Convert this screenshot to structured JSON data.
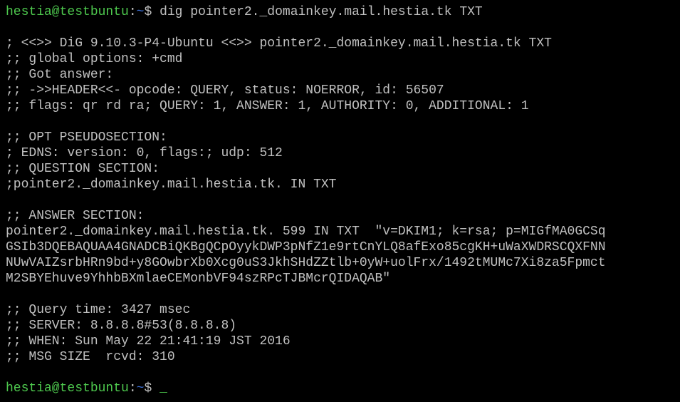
{
  "terminal": {
    "colors": {
      "background": "#000000",
      "foreground": "#c0c0c0",
      "prompt_user": "#4ec94e",
      "prompt_path": "#3b6fd8"
    },
    "prompt": {
      "user_host": "hestia@testbuntu",
      "separator": ":",
      "path": "~",
      "symbol": "$ "
    },
    "command": "dig pointer2._domainkey.mail.hestia.tk TXT",
    "output": [
      "",
      "; <<>> DiG 9.10.3-P4-Ubuntu <<>> pointer2._domainkey.mail.hestia.tk TXT",
      ";; global options: +cmd",
      ";; Got answer:",
      ";; ->>HEADER<<- opcode: QUERY, status: NOERROR, id: 56507",
      ";; flags: qr rd ra; QUERY: 1, ANSWER: 1, AUTHORITY: 0, ADDITIONAL: 1",
      "",
      ";; OPT PSEUDOSECTION:",
      "; EDNS: version: 0, flags:; udp: 512",
      ";; QUESTION SECTION:",
      ";pointer2._domainkey.mail.hestia.tk. IN TXT",
      "",
      ";; ANSWER SECTION:",
      "pointer2._domainkey.mail.hestia.tk. 599 IN TXT  \"v=DKIM1; k=rsa; p=MIGfMA0GCSq",
      "GSIb3DQEBAQUAA4GNADCBiQKBgQCpOyykDWP3pNfZ1e9rtCnYLQ8afExo85cgKH+uWaXWDRSCQXFNN",
      "NUwVAIZsrbHRn9bd+y8GOwbrXb0Xcg0uS3JkhSHdZZtlb+0yW+uolFrx/1492tMUMc7Xi8za5Fpmct",
      "M2SBYEhuve9YhhbBXmlaeCEMonbVF94szRPcTJBMcrQIDAQAB\"",
      "",
      ";; Query time: 3427 msec",
      ";; SERVER: 8.8.8.8#53(8.8.8.8)",
      ";; WHEN: Sun May 22 21:41:19 JST 2016",
      ";; MSG SIZE  rcvd: 310",
      ""
    ],
    "cursor": "_"
  }
}
